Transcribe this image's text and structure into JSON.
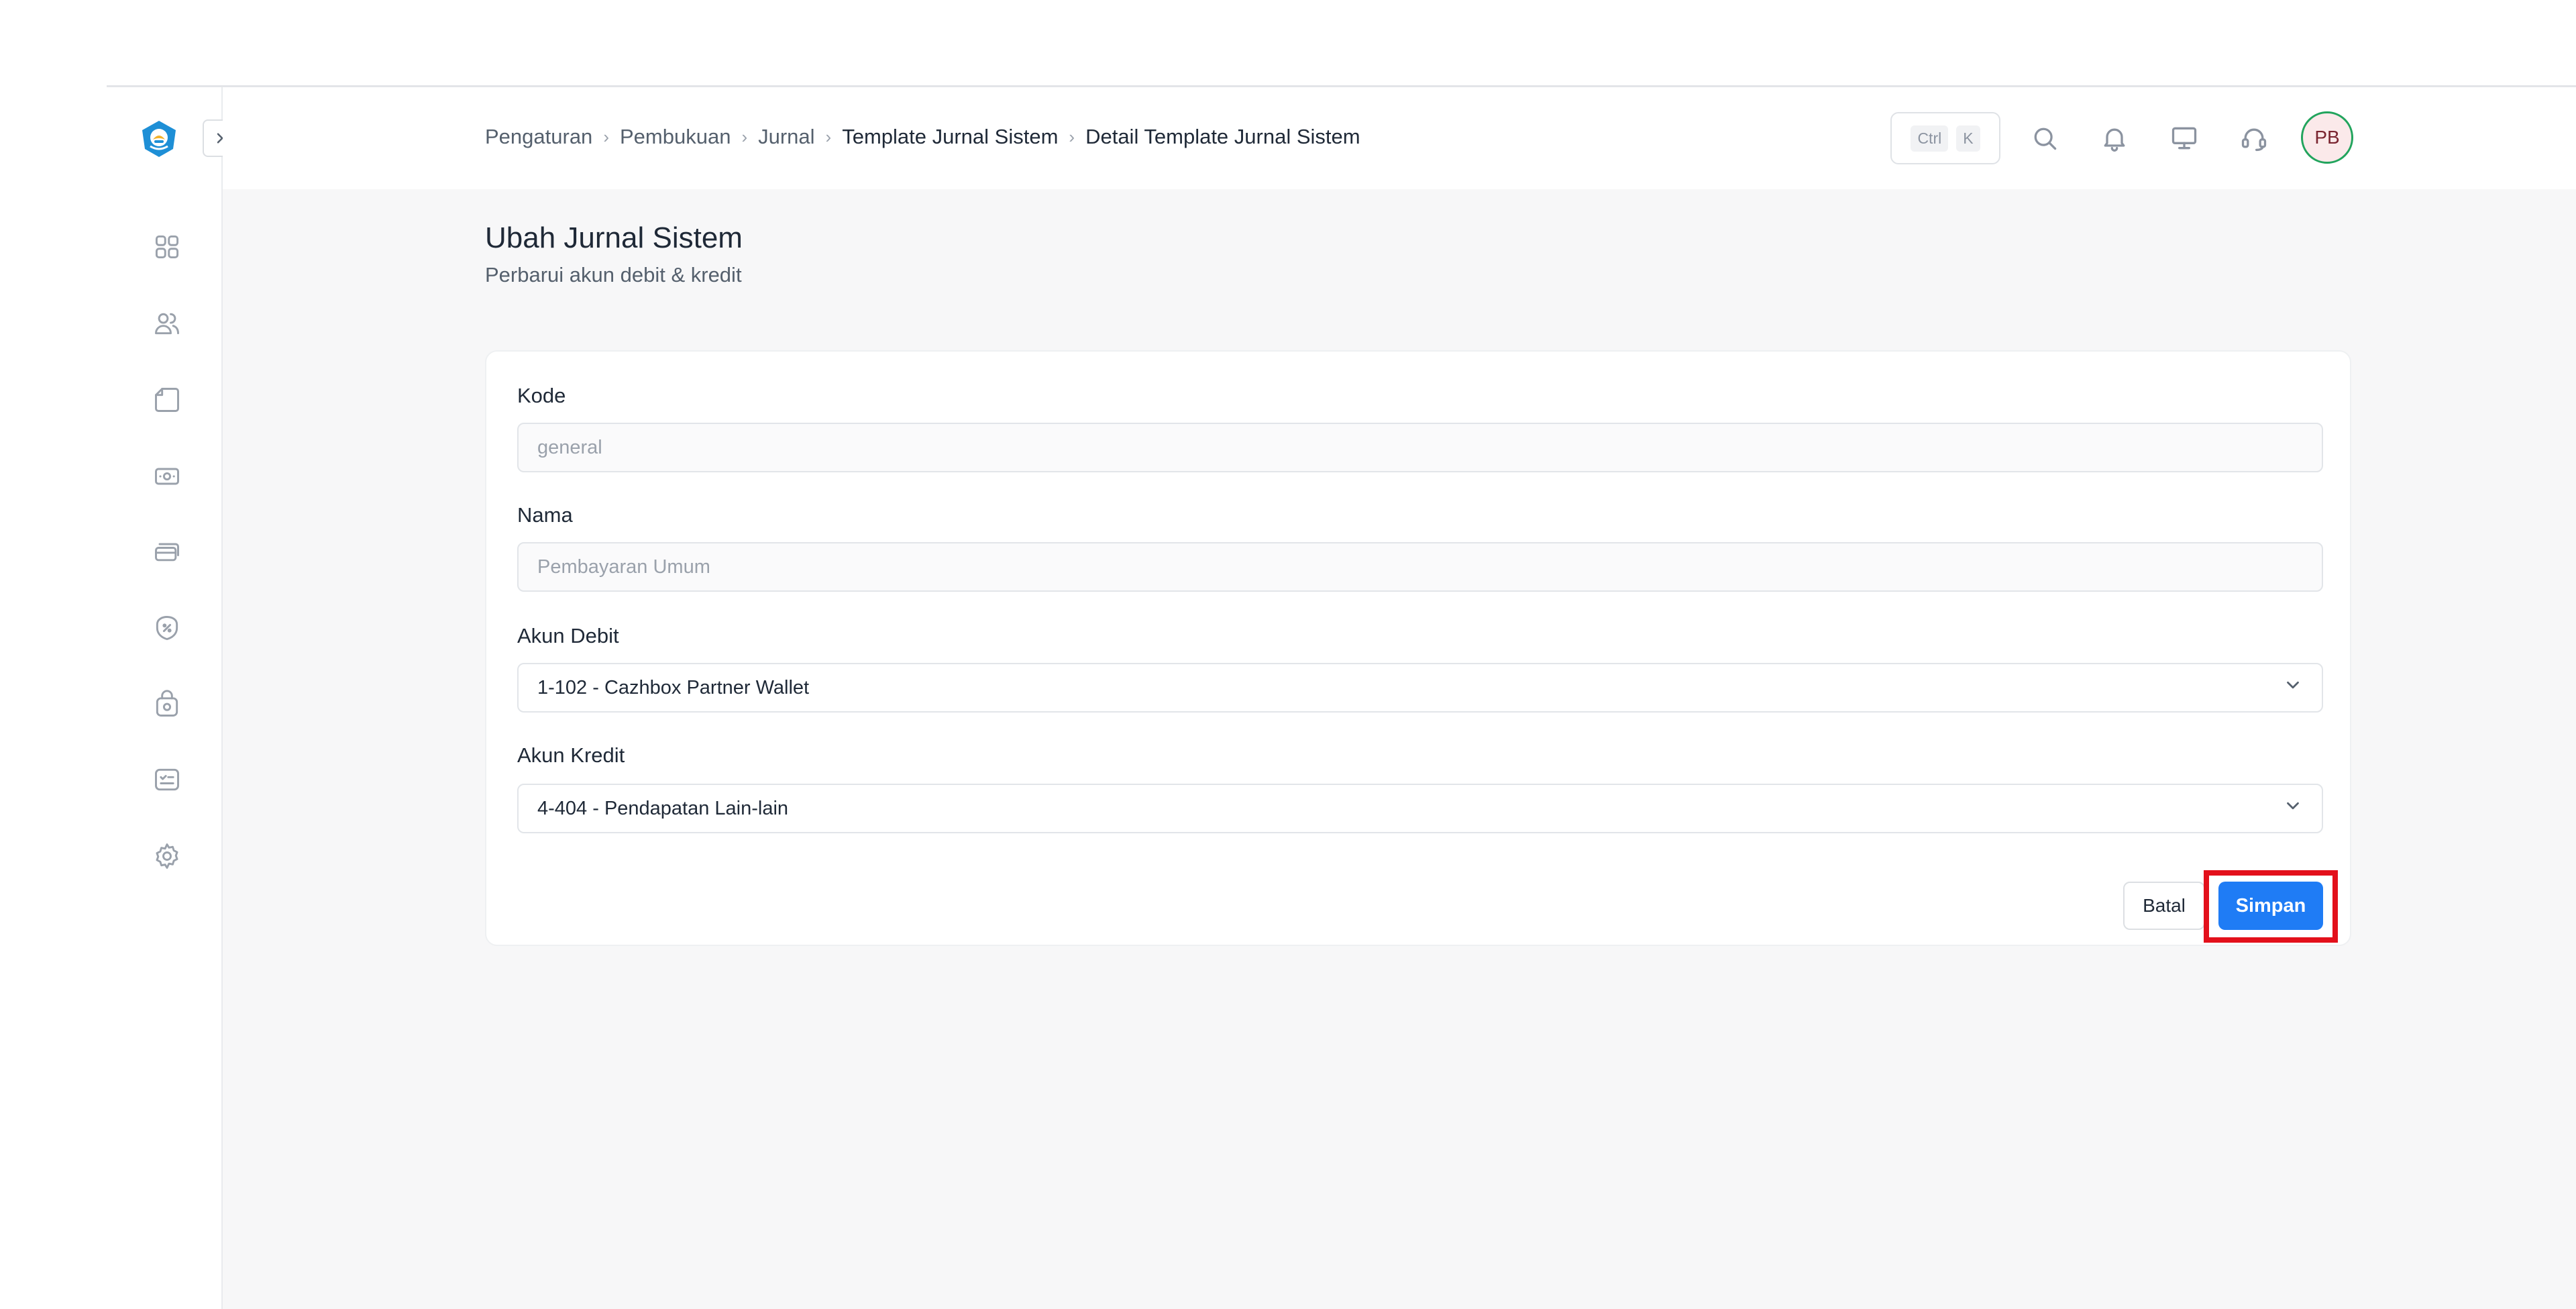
{
  "breadcrumb": {
    "items": [
      "Pengaturan",
      "Pembukuan",
      "Jurnal",
      "Template Jurnal Sistem",
      "Detail Template Jurnal Sistem"
    ],
    "separator": "›"
  },
  "header": {
    "shortcut": [
      "Ctrl",
      "K"
    ],
    "icons": [
      "search-icon",
      "bell-icon",
      "monitor-icon",
      "headset-icon"
    ],
    "avatar_initials": "PB"
  },
  "sidebar": {
    "collapse_icon": "expand-sidebar-icon",
    "items": [
      "dashboard-grid-icon",
      "users-icon",
      "document-icon",
      "cash-icon",
      "cards-icon",
      "discount-badge-icon",
      "bag-icon",
      "checklist-icon",
      "gear-icon"
    ]
  },
  "page": {
    "title": "Ubah Jurnal Sistem",
    "subtitle": "Perbarui akun debit & kredit"
  },
  "form": {
    "kode": {
      "label": "Kode",
      "value": "general"
    },
    "nama": {
      "label": "Nama",
      "value": "Pembayaran Umum"
    },
    "akun_debit": {
      "label": "Akun Debit",
      "value": "1-102 - Cazhbox Partner Wallet"
    },
    "akun_kredit": {
      "label": "Akun Kredit",
      "value": "4-404 - Pendapatan Lain-lain"
    },
    "cancel_label": "Batal",
    "save_label": "Simpan"
  },
  "colors": {
    "primary": "#1f7cf5",
    "highlight": "#e3101b",
    "avatar_ring": "#22a45d"
  }
}
